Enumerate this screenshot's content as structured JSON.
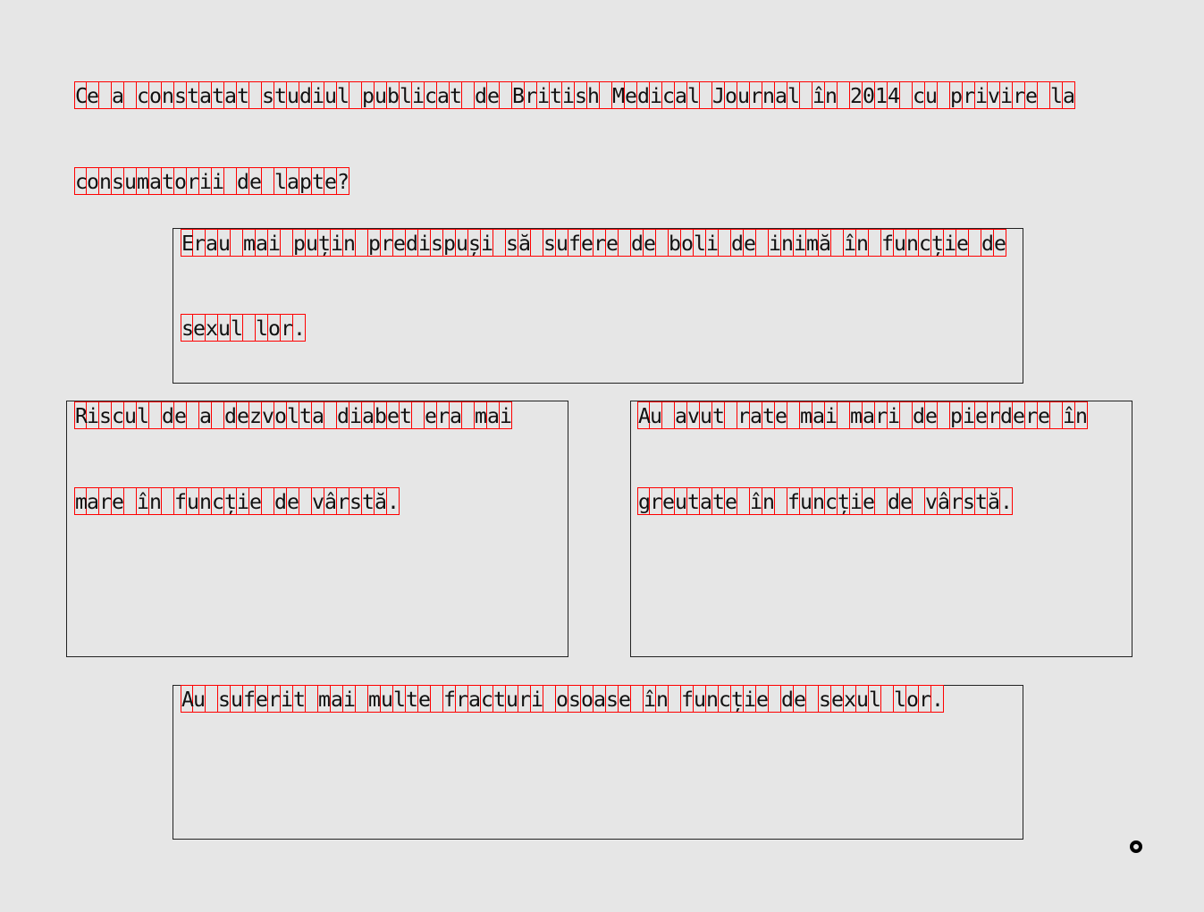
{
  "question": {
    "lines": [
      "Ce a constatat studiul publicat de British Medical Journal în 2014 cu privire la",
      "consumatorii de lapte?"
    ]
  },
  "answers": [
    {
      "lines": [
        "Erau mai puțin predispuși să sufere de boli de inimă în funcție de",
        "sexul lor."
      ]
    },
    {
      "lines": [
        "Riscul de a dezvolta diabet era mai",
        "mare în funcție de vârstă."
      ]
    },
    {
      "lines": [
        "Au avut rate mai mari de pierdere în",
        "greutate în funcție de vârstă."
      ]
    },
    {
      "lines": [
        "Au suferit mai multe fracturi osoase în funcție de sexul lor."
      ]
    }
  ],
  "colors": {
    "char_border": "#ff0000",
    "background": "#e6e6e6"
  }
}
